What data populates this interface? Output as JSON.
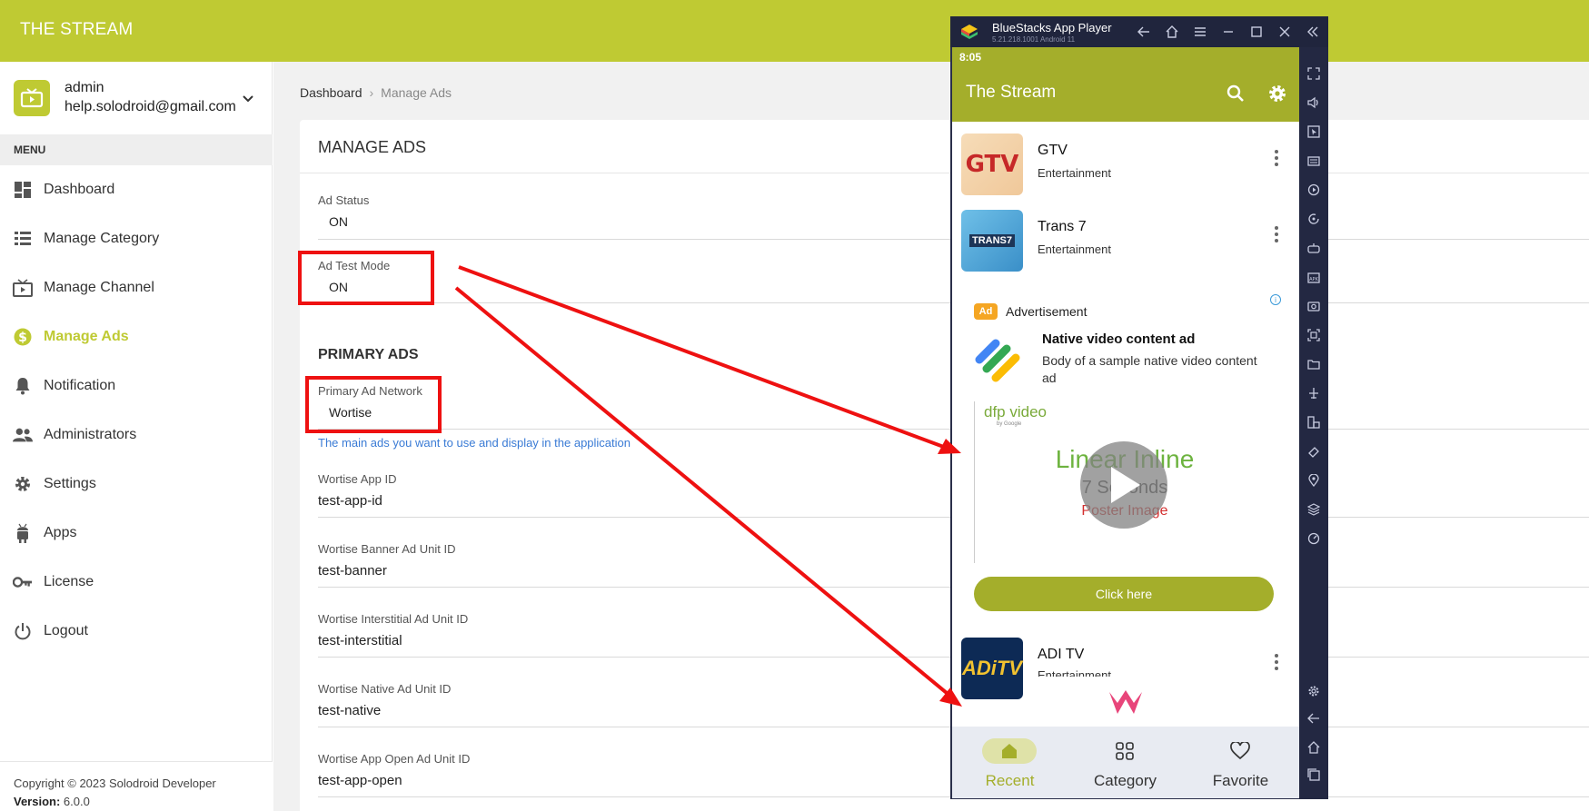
{
  "admin": {
    "brand": "THE STREAM",
    "user": {
      "name": "admin",
      "email": "help.solodroid@gmail.com"
    },
    "menu_header": "MENU",
    "nav": [
      {
        "label": "Dashboard",
        "icon": "dashboard-icon"
      },
      {
        "label": "Manage Category",
        "icon": "list-icon"
      },
      {
        "label": "Manage Channel",
        "icon": "tv-icon"
      },
      {
        "label": "Manage Ads",
        "icon": "dollar-icon",
        "active": true
      },
      {
        "label": "Notification",
        "icon": "bell-icon"
      },
      {
        "label": "Administrators",
        "icon": "people-icon"
      },
      {
        "label": "Settings",
        "icon": "gear-icon"
      },
      {
        "label": "Apps",
        "icon": "android-icon"
      },
      {
        "label": "License",
        "icon": "key-icon"
      },
      {
        "label": "Logout",
        "icon": "power-icon"
      }
    ],
    "footer": {
      "copyright": "Copyright © 2023 Solodroid Developer",
      "version_label": "Version:",
      "version": "6.0.0"
    },
    "breadcrumb": {
      "home": "Dashboard",
      "current": "Manage Ads"
    },
    "card_title": "MANAGE ADS",
    "fields": {
      "ad_status": {
        "label": "Ad Status",
        "value": "ON"
      },
      "ad_test_mode": {
        "label": "Ad Test Mode",
        "value": "ON"
      },
      "primary_section": "PRIMARY ADS",
      "primary_network": {
        "label": "Primary Ad Network",
        "value": "Wortise"
      },
      "help": "The main ads you want to use and display in the application",
      "app_id": {
        "label": "Wortise App ID",
        "value": "test-app-id"
      },
      "banner": {
        "label": "Wortise Banner Ad Unit ID",
        "value": "test-banner"
      },
      "interstitial": {
        "label": "Wortise Interstitial Ad Unit ID",
        "value": "test-interstitial"
      },
      "native": {
        "label": "Wortise Native Ad Unit ID",
        "value": "test-native"
      },
      "app_open": {
        "label": "Wortise App Open Ad Unit ID",
        "value": "test-app-open"
      }
    }
  },
  "emulator": {
    "title": "BlueStacks App Player",
    "version": "5.21.218.1001  Android 11",
    "status_time": "8:05",
    "app_title": "The Stream",
    "channels": [
      {
        "name": "GTV",
        "category": "Entertainment",
        "logo": "GTV"
      },
      {
        "name": "Trans 7",
        "category": "Entertainment",
        "logo": "TRANS7"
      },
      {
        "name": "ADI TV",
        "category": "Entertainment",
        "logo": "ADiTV"
      }
    ],
    "ad": {
      "badge": "Ad",
      "label": "Advertisement",
      "headline": "Native video content ad",
      "body": "Body of a sample native video content ad",
      "dfp_brand": "dfp video",
      "dfp_sub": "by Google",
      "video_title": "Linear Inline",
      "video_sub": "7 Seconds",
      "video_poster": "Poster Image",
      "cta": "Click here"
    },
    "bottom_nav": [
      {
        "label": "Recent",
        "icon": "home-icon",
        "active": true
      },
      {
        "label": "Category",
        "icon": "grid-icon"
      },
      {
        "label": "Favorite",
        "icon": "heart-icon"
      }
    ]
  },
  "colors": {
    "brand": "#bfca33",
    "app_bar": "#a4ae2b",
    "annotation": "#ee1111",
    "help_text": "#3a7bd5"
  }
}
